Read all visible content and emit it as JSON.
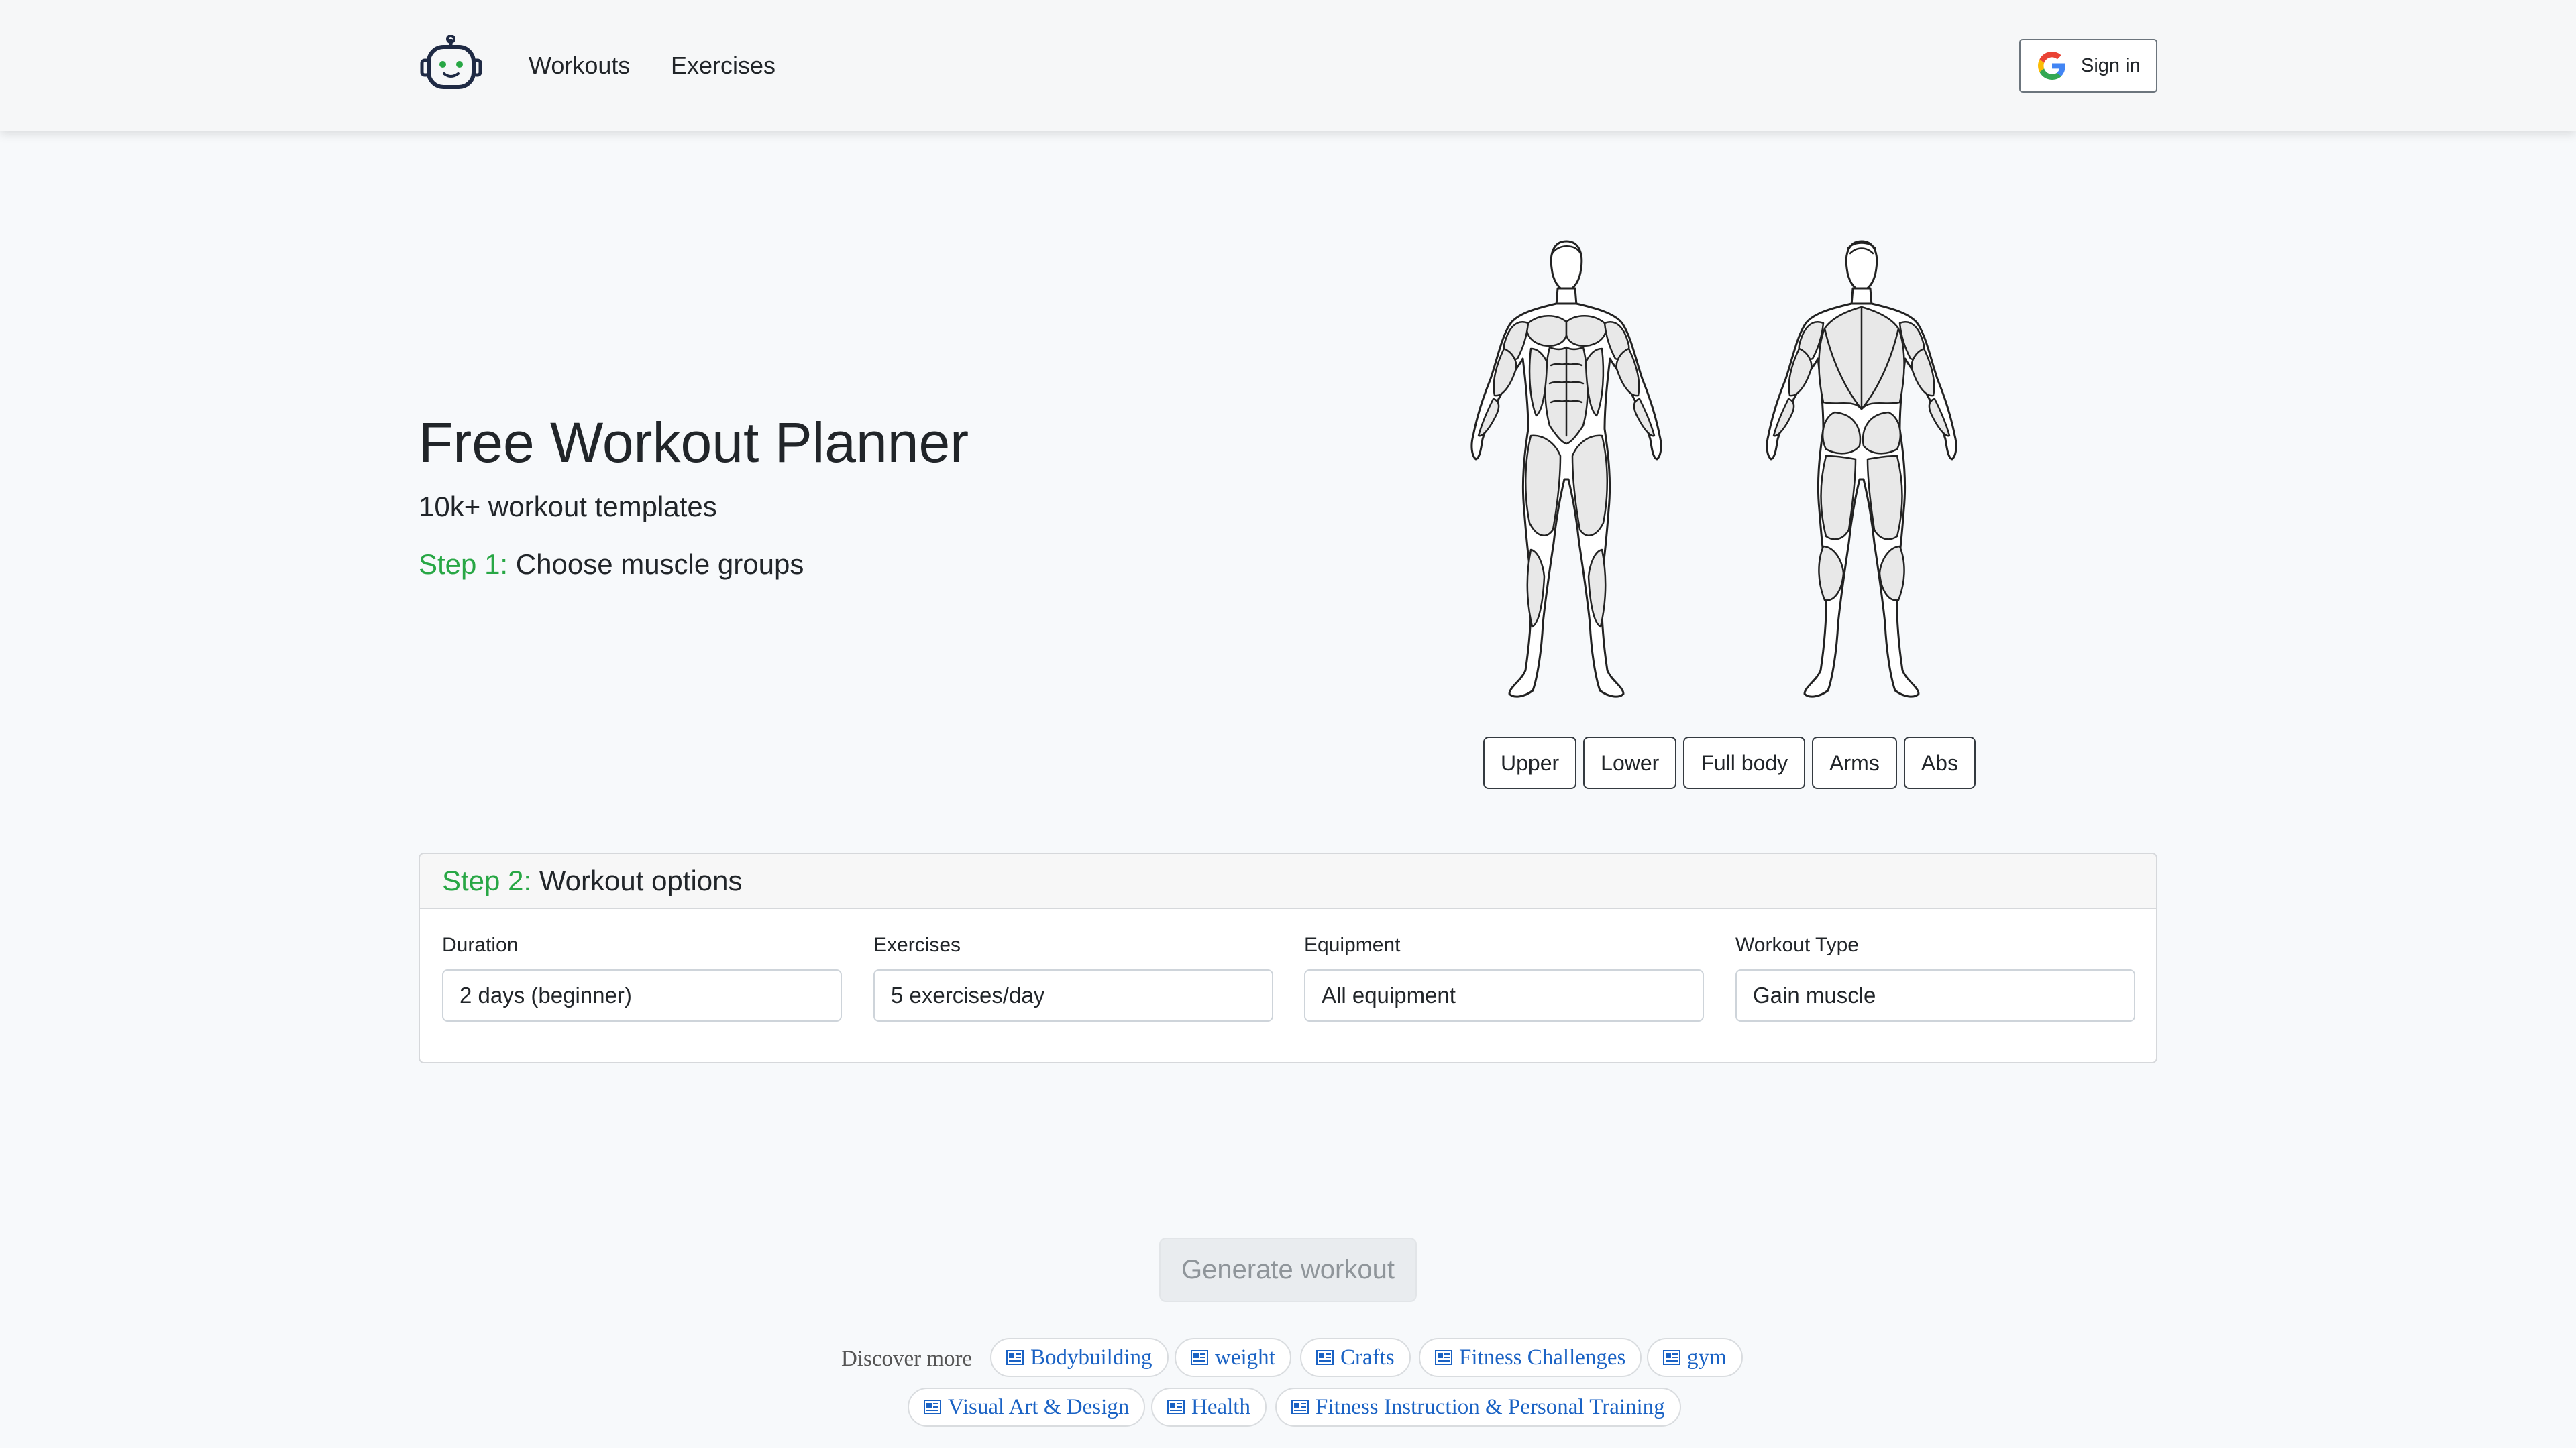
{
  "header": {
    "nav": [
      {
        "label": "Workouts"
      },
      {
        "label": "Exercises"
      }
    ],
    "signin_label": "Sign in"
  },
  "hero": {
    "title": "Free Workout Planner",
    "subtitle": "10k+ workout templates",
    "step1_label": "Step 1:",
    "step1_text": "Choose muscle groups"
  },
  "muscle_groups": [
    "Upper",
    "Lower",
    "Full body",
    "Arms",
    "Abs"
  ],
  "options": {
    "step2_label": "Step 2:",
    "step2_text": "Workout options",
    "fields": [
      {
        "label": "Duration",
        "value": "2 days (beginner)"
      },
      {
        "label": "Exercises",
        "value": "5 exercises/day"
      },
      {
        "label": "Equipment",
        "value": "All equipment"
      },
      {
        "label": "Workout Type",
        "value": "Gain muscle"
      }
    ]
  },
  "generate_label": "Generate workout",
  "discover": {
    "label": "Discover more",
    "chips": [
      "Bodybuilding",
      "weight",
      "Crafts",
      "Fitness Challenges",
      "gym",
      "Visual Art & Design",
      "Health",
      "Fitness Instruction & Personal Training"
    ]
  },
  "colors": {
    "step_accent": "#28a745",
    "link_blue": "#1a62c4",
    "logo_eye": "#28a745"
  },
  "icons": {
    "logo": "robot-icon",
    "signin": "google-icon",
    "chip": "news-icon"
  }
}
